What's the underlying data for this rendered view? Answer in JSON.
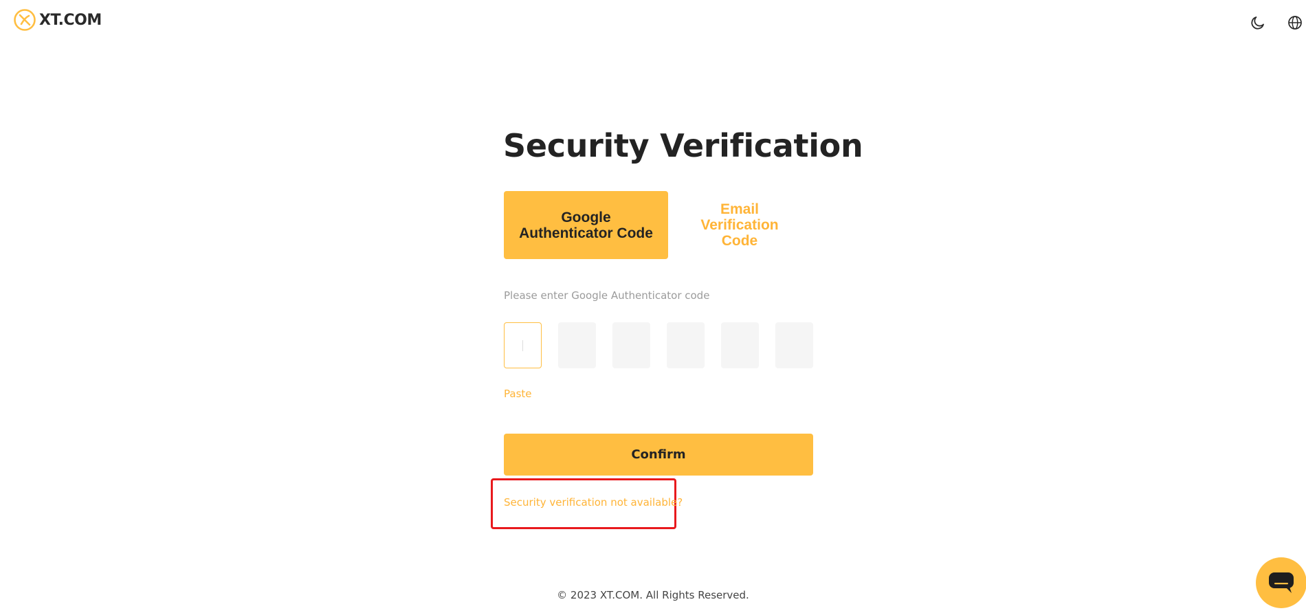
{
  "header": {
    "brand": "XT.COM",
    "brand_color": "#ffbe41",
    "theme_icon": "moon-icon",
    "language_icon": "globe-icon"
  },
  "main": {
    "title": "Security Verification",
    "tabs": [
      {
        "label_lines": [
          "Google",
          "Authenticator Code"
        ],
        "active": true
      },
      {
        "label_lines": [
          "Email",
          "Verification",
          "Code"
        ],
        "active": false
      }
    ],
    "code_hint": "Please enter Google Authenticator code",
    "code_digits": [
      "",
      "",
      "",
      "",
      "",
      ""
    ],
    "paste_label": "Paste",
    "confirm_label": "Confirm",
    "not_available_link": "Security verification not available?"
  },
  "footer": {
    "copyright": "© 2023 XT.COM. All Rights Reserved."
  },
  "chat": {
    "icon": "chat-bubble-icon"
  },
  "colors": {
    "accent": "#ffbe41",
    "accent_text": "#ffb437",
    "highlight": "#e8191d"
  }
}
